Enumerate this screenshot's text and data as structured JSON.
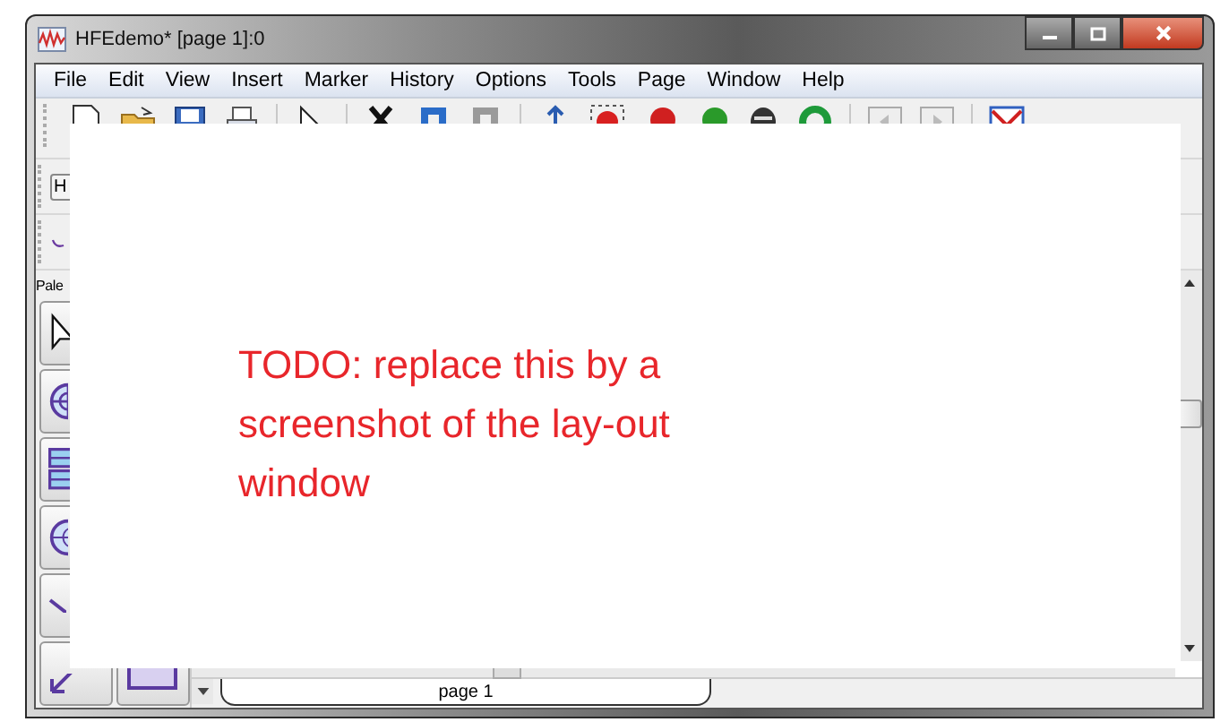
{
  "window": {
    "title": "HFEdemo* [page 1]:0"
  },
  "menu": [
    "File",
    "Edit",
    "View",
    "Insert",
    "Marker",
    "History",
    "Options",
    "Tools",
    "Page",
    "Window",
    "Help"
  ],
  "toolbar_field": {
    "value": "H"
  },
  "palette": {
    "title": "Pale"
  },
  "page_tabs": [
    {
      "label": "page 1",
      "selected": true
    }
  ],
  "note": {
    "text": "TODO: replace this by a screenshot of the lay-out window"
  }
}
